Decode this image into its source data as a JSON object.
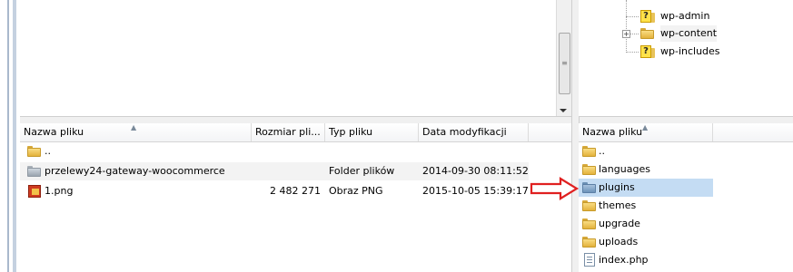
{
  "remote_tree": {
    "items": [
      {
        "label": "wp-admin",
        "icon": "question-folder-icon",
        "expander": ""
      },
      {
        "label": "wp-content",
        "icon": "folder-icon",
        "expander": "+"
      },
      {
        "label": "wp-includes",
        "icon": "question-folder-icon",
        "expander": ""
      }
    ]
  },
  "local_list": {
    "columns": [
      "Nazwa pliku",
      "Rozmiar pli...",
      "Typ pliku",
      "Data modyfikacji"
    ],
    "rows": [
      {
        "name": "..",
        "size": "",
        "type": "",
        "date": "",
        "icon": "folder-icon"
      },
      {
        "name": "przelewy24-gateway-woocommerce",
        "size": "",
        "type": "Folder plików",
        "date": "2014-09-30 08:11:52",
        "icon": "grey-folder-icon"
      },
      {
        "name": "1.png",
        "size": "2 482 271",
        "type": "Obraz PNG",
        "date": "2015-10-05 15:39:17",
        "icon": "png-image-icon"
      }
    ]
  },
  "remote_list": {
    "columns": [
      "Nazwa pliku"
    ],
    "rows": [
      {
        "name": "..",
        "icon": "folder-icon"
      },
      {
        "name": "languages",
        "icon": "folder-icon"
      },
      {
        "name": "plugins",
        "icon": "blue-folder-icon"
      },
      {
        "name": "themes",
        "icon": "folder-icon"
      },
      {
        "name": "upgrade",
        "icon": "folder-icon"
      },
      {
        "name": "uploads",
        "icon": "folder-icon"
      },
      {
        "name": "index.php",
        "icon": "file-icon"
      }
    ]
  },
  "colors": {
    "selection": "#c4dcf3",
    "hover_row": "#f3f3f3",
    "annotation_arrow": "#e02020"
  }
}
